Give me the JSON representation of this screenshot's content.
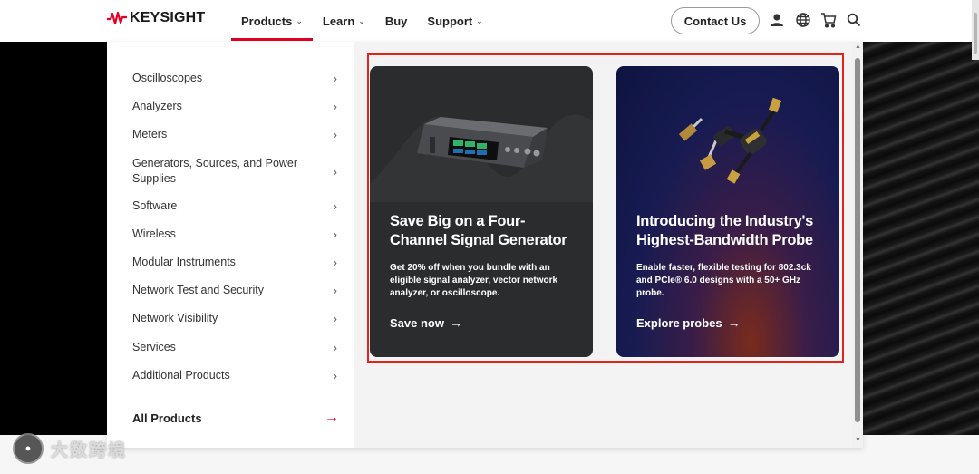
{
  "header": {
    "logo_text": "KEYSIGHT",
    "nav": [
      {
        "label": "Products",
        "chevron": true,
        "active": true
      },
      {
        "label": "Learn",
        "chevron": true,
        "active": false
      },
      {
        "label": "Buy",
        "chevron": false,
        "active": false
      },
      {
        "label": "Support",
        "chevron": true,
        "active": false
      }
    ],
    "contact_label": "Contact Us",
    "icons": [
      "user-icon",
      "globe-icon",
      "cart-icon",
      "search-icon"
    ],
    "accent_color": "#e20025"
  },
  "menu": {
    "items": [
      {
        "label": "Oscilloscopes"
      },
      {
        "label": "Analyzers"
      },
      {
        "label": "Meters"
      },
      {
        "label": "Generators, Sources, and Power Supplies"
      },
      {
        "label": "Software"
      },
      {
        "label": "Wireless"
      },
      {
        "label": "Modular Instruments"
      },
      {
        "label": "Network Test and Security"
      },
      {
        "label": "Network Visibility"
      },
      {
        "label": "Services"
      },
      {
        "label": "Additional Products"
      }
    ],
    "all_products_label": "All Products"
  },
  "promos": [
    {
      "title": "Save Big on a Four-Channel Signal Generator",
      "description": "Get 20% off when you bundle with an eligible signal analyzer, vector network analyzer, or oscilloscope.",
      "link_label": "Save now",
      "image": "signal-generator-image"
    },
    {
      "title": "Introducing the Industry's Highest-Bandwidth Probe",
      "description": "Enable faster, flexible testing for 802.3ck and PCIe® 6.0 designs with a 50+ GHz probe.",
      "link_label": "Explore probes",
      "image": "probe-image"
    }
  ],
  "watermark_text": "大数跨境"
}
